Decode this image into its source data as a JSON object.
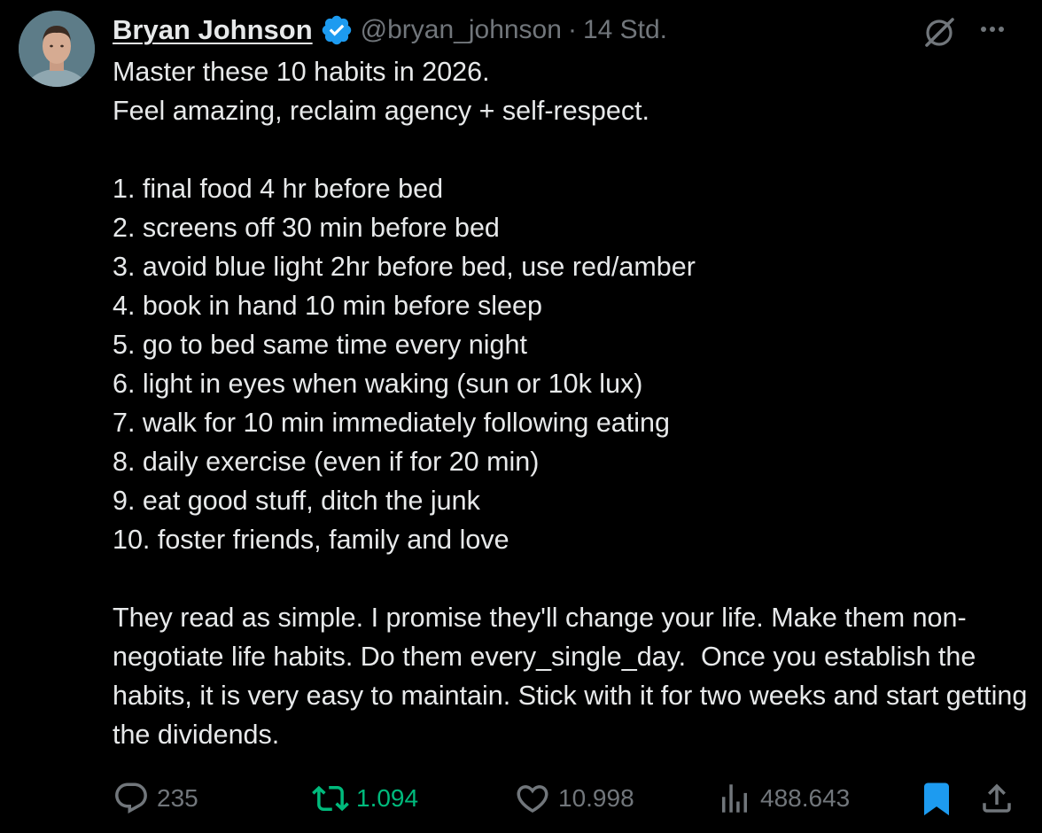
{
  "author": {
    "display_name": "Bryan Johnson",
    "handle": "@bryan_johnson",
    "separator": "·",
    "timestamp": "14 Std.",
    "verified": true,
    "verified_color": "#1d9bf0",
    "avatar_icon": "avatar-photo"
  },
  "header_icons": {
    "grok": "grok-icon",
    "more": "more-icon"
  },
  "tweet": {
    "paragraphs": [
      "Master these 10 habits in 2026.\nFeel amazing, reclaim agency + self-respect.",
      "1. final food 4 hr before bed\n2. screens off 30 min before bed\n3. avoid blue light 2hr before bed, use red/amber\n4. book in hand 10 min before sleep\n5. go to bed same time every night\n6. light in eyes when waking (sun or 10k lux)\n7. walk for 10 min immediately following eating\n8. daily exercise (even if for 20 min)\n9. eat good stuff, ditch the junk\n10. foster friends, family and love",
      "They read as simple. I promise they'll change your life. Make them non-negotiate life habits. Do them every_single_day.  Once you establish the habits, it is very easy to maintain. Stick with it for two weeks and start getting the dividends."
    ]
  },
  "actions": {
    "reply": {
      "icon": "reply-icon",
      "count": "235"
    },
    "repost": {
      "icon": "repost-icon",
      "count": "1.094",
      "active_color": "#00ba7c"
    },
    "like": {
      "icon": "heart-icon",
      "count": "10.998"
    },
    "views": {
      "icon": "views-icon",
      "count": "488.643"
    },
    "bookmark": {
      "icon": "bookmark-icon",
      "active": true,
      "active_color": "#1d9bf0"
    },
    "share": {
      "icon": "share-icon"
    }
  },
  "colors": {
    "background": "#000000",
    "text": "#e7e9ea",
    "secondary_text": "#71767b"
  }
}
